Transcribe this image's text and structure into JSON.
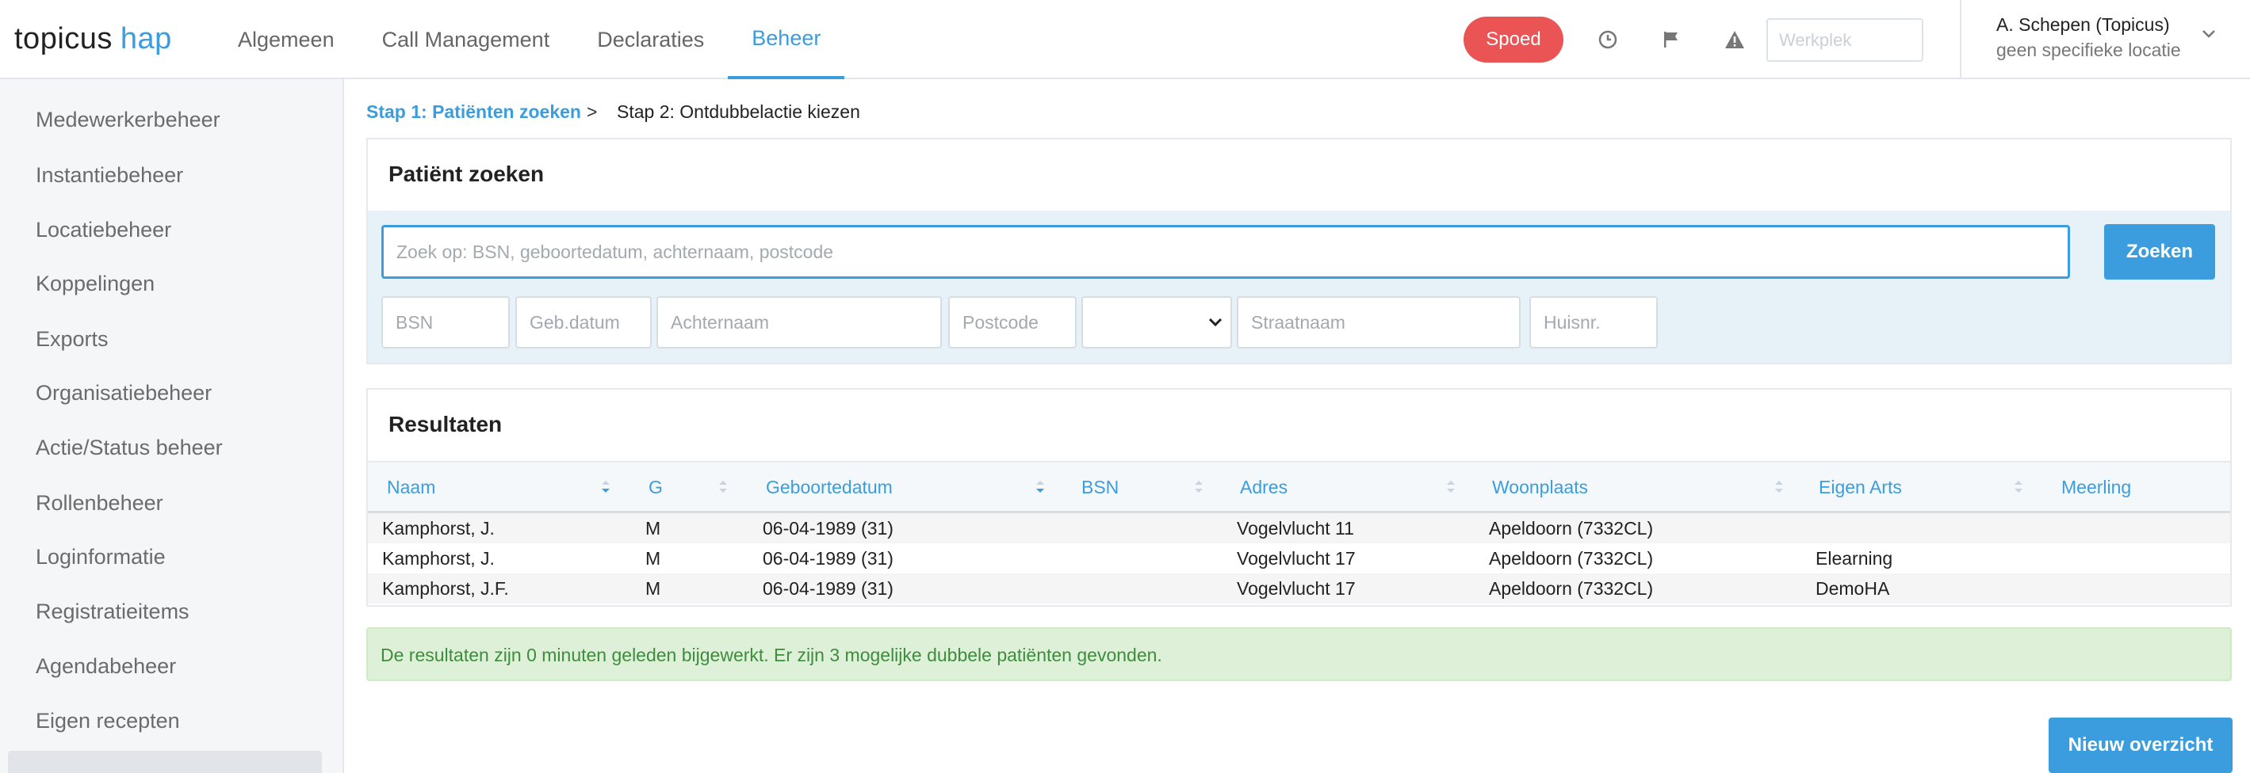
{
  "brand": {
    "part1": "topicus",
    "part2": "hap"
  },
  "nav": [
    "Algemeen",
    "Call Management",
    "Declaraties",
    "Beheer"
  ],
  "header": {
    "spoed_label": "Spoed",
    "workplek_placeholder": "Werkplek",
    "user_name": "A. Schepen (Topicus)",
    "user_location": "geen specifieke locatie",
    "icons": [
      "clock-icon",
      "flag-icon",
      "warning-icon",
      "chevron-down-icon"
    ]
  },
  "sidebar": {
    "items": [
      "Medewerkerbeheer",
      "Instantiebeheer",
      "Locatiebeheer",
      "Koppelingen",
      "Exports",
      "Organisatiebeheer",
      "Actie/Status beheer",
      "Rollenbeheer",
      "Loginformatie",
      "Registratieitems",
      "Agendabeheer",
      "Eigen recepten"
    ]
  },
  "breadcrumb": {
    "step1": "Stap 1: Patiënten zoeken",
    "separator": ">",
    "step2": "Stap 2: Ontdubbelactie kiezen"
  },
  "search": {
    "title": "Patiënt zoeken",
    "main_placeholder": "Zoek op: BSN, geboortedatum, achternaam, postcode",
    "button": "Zoeken",
    "fields": {
      "bsn": "BSN",
      "geb": "Geb.datum",
      "achternaam": "Achternaam",
      "postcode": "Postcode",
      "straatnaam": "Straatnaam",
      "huisnr": "Huisnr."
    }
  },
  "results": {
    "title": "Resultaten",
    "columns": [
      "Naam",
      "G",
      "Geboortedatum",
      "BSN",
      "Adres",
      "Woonplaats",
      "Eigen Arts",
      "Meerling"
    ],
    "rows": [
      [
        "Kamphorst, J.",
        "M",
        "06-04-1989 (31)",
        "",
        "Vogelvlucht 11",
        "Apeldoorn (7332CL)",
        "",
        ""
      ],
      [
        "Kamphorst, J.",
        "M",
        "06-04-1989 (31)",
        "",
        "Vogelvlucht 17",
        "Apeldoorn (7332CL)",
        "Elearning",
        ""
      ],
      [
        "Kamphorst, J.F.",
        "M",
        "06-04-1989 (31)",
        "",
        "Vogelvlucht 17",
        "Apeldoorn (7332CL)",
        "DemoHA",
        ""
      ]
    ]
  },
  "message": "De resultaten zijn 0 minuten geleden bijgewerkt. Er zijn 3 mogelijke dubbele patiënten gevonden.",
  "new_overview_button": "Nieuw overzicht",
  "colors": {
    "accent": "#3b9ddd",
    "spoed": "#ea5455",
    "success_bg": "#dff0d8"
  }
}
